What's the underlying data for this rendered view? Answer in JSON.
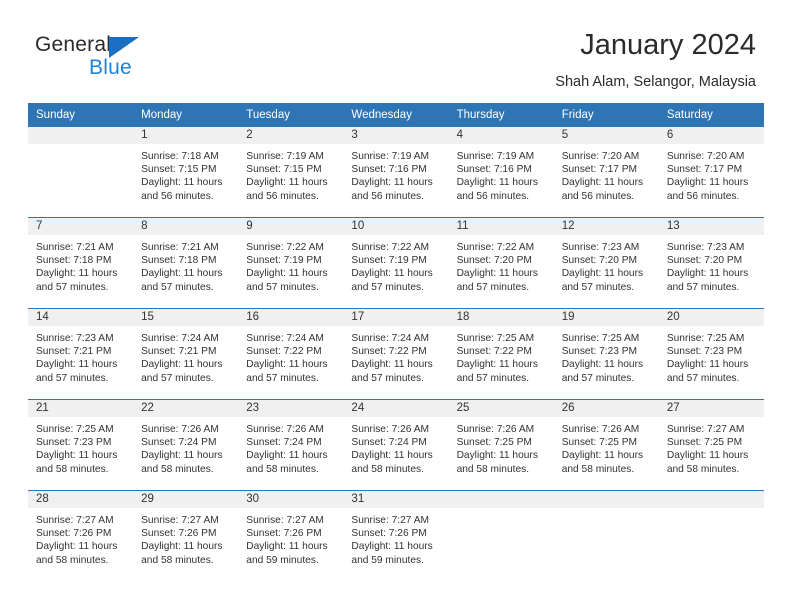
{
  "brand": {
    "name_part1": "General",
    "name_part2": "Blue",
    "triangle_icon": "blue-triangle-logo-icon",
    "color_dark": "#2b2b2b",
    "color_blue": "#1f83d8",
    "color_triangle": "#1b6ec2"
  },
  "header": {
    "title": "January 2024",
    "subtitle": "Shah Alam, Selangor, Malaysia"
  },
  "theme": {
    "header_row_bg": "#2e75b6",
    "header_row_text": "#ffffff",
    "daynum_bg": "#f0f0f0",
    "cell_bg": "#ffffff",
    "separator": "#2e75b6",
    "body_text": "#333333"
  },
  "weekday_headers": [
    "Sunday",
    "Monday",
    "Tuesday",
    "Wednesday",
    "Thursday",
    "Friday",
    "Saturday"
  ],
  "weeks": [
    [
      {
        "day": "",
        "lines": []
      },
      {
        "day": "1",
        "lines": [
          "Sunrise: 7:18 AM",
          "Sunset: 7:15 PM",
          "Daylight: 11 hours",
          "and 56 minutes."
        ]
      },
      {
        "day": "2",
        "lines": [
          "Sunrise: 7:19 AM",
          "Sunset: 7:15 PM",
          "Daylight: 11 hours",
          "and 56 minutes."
        ]
      },
      {
        "day": "3",
        "lines": [
          "Sunrise: 7:19 AM",
          "Sunset: 7:16 PM",
          "Daylight: 11 hours",
          "and 56 minutes."
        ]
      },
      {
        "day": "4",
        "lines": [
          "Sunrise: 7:19 AM",
          "Sunset: 7:16 PM",
          "Daylight: 11 hours",
          "and 56 minutes."
        ]
      },
      {
        "day": "5",
        "lines": [
          "Sunrise: 7:20 AM",
          "Sunset: 7:17 PM",
          "Daylight: 11 hours",
          "and 56 minutes."
        ]
      },
      {
        "day": "6",
        "lines": [
          "Sunrise: 7:20 AM",
          "Sunset: 7:17 PM",
          "Daylight: 11 hours",
          "and 56 minutes."
        ]
      }
    ],
    [
      {
        "day": "7",
        "lines": [
          "Sunrise: 7:21 AM",
          "Sunset: 7:18 PM",
          "Daylight: 11 hours",
          "and 57 minutes."
        ]
      },
      {
        "day": "8",
        "lines": [
          "Sunrise: 7:21 AM",
          "Sunset: 7:18 PM",
          "Daylight: 11 hours",
          "and 57 minutes."
        ]
      },
      {
        "day": "9",
        "lines": [
          "Sunrise: 7:22 AM",
          "Sunset: 7:19 PM",
          "Daylight: 11 hours",
          "and 57 minutes."
        ]
      },
      {
        "day": "10",
        "lines": [
          "Sunrise: 7:22 AM",
          "Sunset: 7:19 PM",
          "Daylight: 11 hours",
          "and 57 minutes."
        ]
      },
      {
        "day": "11",
        "lines": [
          "Sunrise: 7:22 AM",
          "Sunset: 7:20 PM",
          "Daylight: 11 hours",
          "and 57 minutes."
        ]
      },
      {
        "day": "12",
        "lines": [
          "Sunrise: 7:23 AM",
          "Sunset: 7:20 PM",
          "Daylight: 11 hours",
          "and 57 minutes."
        ]
      },
      {
        "day": "13",
        "lines": [
          "Sunrise: 7:23 AM",
          "Sunset: 7:20 PM",
          "Daylight: 11 hours",
          "and 57 minutes."
        ]
      }
    ],
    [
      {
        "day": "14",
        "lines": [
          "Sunrise: 7:23 AM",
          "Sunset: 7:21 PM",
          "Daylight: 11 hours",
          "and 57 minutes."
        ]
      },
      {
        "day": "15",
        "lines": [
          "Sunrise: 7:24 AM",
          "Sunset: 7:21 PM",
          "Daylight: 11 hours",
          "and 57 minutes."
        ]
      },
      {
        "day": "16",
        "lines": [
          "Sunrise: 7:24 AM",
          "Sunset: 7:22 PM",
          "Daylight: 11 hours",
          "and 57 minutes."
        ]
      },
      {
        "day": "17",
        "lines": [
          "Sunrise: 7:24 AM",
          "Sunset: 7:22 PM",
          "Daylight: 11 hours",
          "and 57 minutes."
        ]
      },
      {
        "day": "18",
        "lines": [
          "Sunrise: 7:25 AM",
          "Sunset: 7:22 PM",
          "Daylight: 11 hours",
          "and 57 minutes."
        ]
      },
      {
        "day": "19",
        "lines": [
          "Sunrise: 7:25 AM",
          "Sunset: 7:23 PM",
          "Daylight: 11 hours",
          "and 57 minutes."
        ]
      },
      {
        "day": "20",
        "lines": [
          "Sunrise: 7:25 AM",
          "Sunset: 7:23 PM",
          "Daylight: 11 hours",
          "and 57 minutes."
        ]
      }
    ],
    [
      {
        "day": "21",
        "lines": [
          "Sunrise: 7:25 AM",
          "Sunset: 7:23 PM",
          "Daylight: 11 hours",
          "and 58 minutes."
        ]
      },
      {
        "day": "22",
        "lines": [
          "Sunrise: 7:26 AM",
          "Sunset: 7:24 PM",
          "Daylight: 11 hours",
          "and 58 minutes."
        ]
      },
      {
        "day": "23",
        "lines": [
          "Sunrise: 7:26 AM",
          "Sunset: 7:24 PM",
          "Daylight: 11 hours",
          "and 58 minutes."
        ]
      },
      {
        "day": "24",
        "lines": [
          "Sunrise: 7:26 AM",
          "Sunset: 7:24 PM",
          "Daylight: 11 hours",
          "and 58 minutes."
        ]
      },
      {
        "day": "25",
        "lines": [
          "Sunrise: 7:26 AM",
          "Sunset: 7:25 PM",
          "Daylight: 11 hours",
          "and 58 minutes."
        ]
      },
      {
        "day": "26",
        "lines": [
          "Sunrise: 7:26 AM",
          "Sunset: 7:25 PM",
          "Daylight: 11 hours",
          "and 58 minutes."
        ]
      },
      {
        "day": "27",
        "lines": [
          "Sunrise: 7:27 AM",
          "Sunset: 7:25 PM",
          "Daylight: 11 hours",
          "and 58 minutes."
        ]
      }
    ],
    [
      {
        "day": "28",
        "lines": [
          "Sunrise: 7:27 AM",
          "Sunset: 7:26 PM",
          "Daylight: 11 hours",
          "and 58 minutes."
        ]
      },
      {
        "day": "29",
        "lines": [
          "Sunrise: 7:27 AM",
          "Sunset: 7:26 PM",
          "Daylight: 11 hours",
          "and 58 minutes."
        ]
      },
      {
        "day": "30",
        "lines": [
          "Sunrise: 7:27 AM",
          "Sunset: 7:26 PM",
          "Daylight: 11 hours",
          "and 59 minutes."
        ]
      },
      {
        "day": "31",
        "lines": [
          "Sunrise: 7:27 AM",
          "Sunset: 7:26 PM",
          "Daylight: 11 hours",
          "and 59 minutes."
        ]
      },
      {
        "day": "",
        "lines": []
      },
      {
        "day": "",
        "lines": []
      },
      {
        "day": "",
        "lines": []
      }
    ]
  ]
}
